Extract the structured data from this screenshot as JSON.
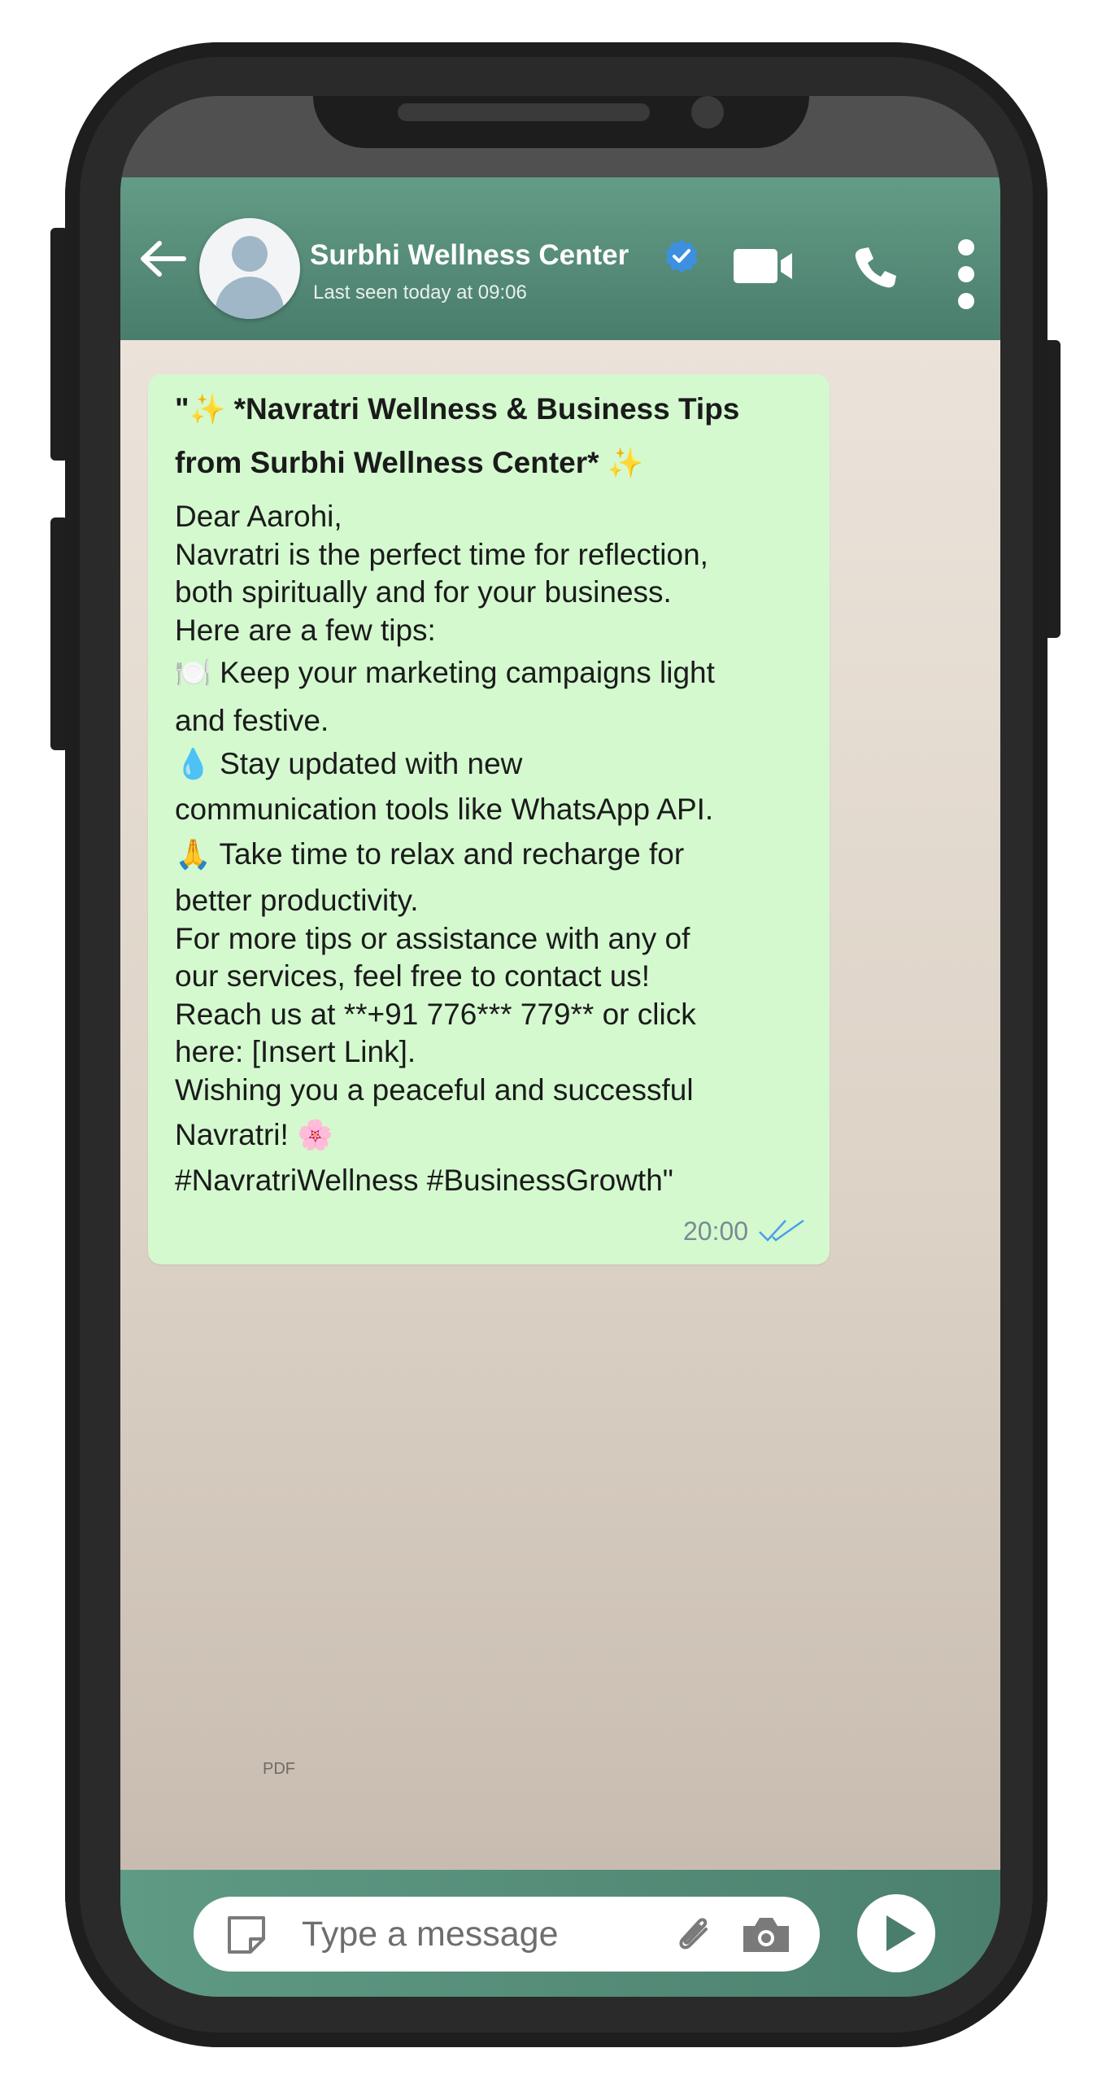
{
  "header": {
    "contact_name": "Surbhi Wellness Center",
    "last_seen": "Last seen today at 09:06",
    "icons": [
      "back-arrow-icon",
      "avatar",
      "verified-badge-icon",
      "video-call-icon",
      "phone-call-icon",
      "more-options-icon"
    ]
  },
  "message": {
    "lines": [
      {
        "pre": "\"",
        "emoji": "✨",
        "text": " *Navratri Wellness & Business Tips",
        "bold": true
      },
      {
        "text": "from Surbhi Wellness Center* ",
        "emoji_after": "✨",
        "bold": true
      },
      {
        "text": "Dear Aarohi,"
      },
      {
        "text": "Navratri is the perfect time for reflection,"
      },
      {
        "text": "both spiritually and for your business."
      },
      {
        "text": "Here are a few tips:"
      },
      {
        "emoji": "🍽️",
        "text": " Keep your marketing campaigns light"
      },
      {
        "text": "and festive."
      },
      {
        "emoji": "💧",
        "text": " Stay updated with new"
      },
      {
        "text": "communication tools like WhatsApp API."
      },
      {
        "emoji": "🙏",
        "text": " Take time to relax and recharge for"
      },
      {
        "text": "better productivity."
      },
      {
        "text": "For more tips or assistance with any of"
      },
      {
        "text": "our services, feel free to contact us!"
      },
      {
        "text": "Reach us at **+91 776*** 779** or click"
      },
      {
        "text": "here: [Insert Link]."
      },
      {
        "text": "Wishing you a peaceful and successful"
      },
      {
        "text": "Navratri! ",
        "emoji_after": "🌸"
      },
      {
        "text": "#NavratriWellness #BusinessGrowth\""
      }
    ],
    "time": "20:00",
    "status": "read",
    "tick_color": "#4a9ee8"
  },
  "chat": {
    "pdf_label": "PDF"
  },
  "composer": {
    "placeholder": "Type a message",
    "icons": [
      "sticker-icon",
      "attach-paperclip-icon",
      "camera-icon",
      "send-icon"
    ]
  },
  "colors": {
    "header": "#5b917d",
    "bubble": "#d4f9cf",
    "verified": "#3d8fe0"
  }
}
